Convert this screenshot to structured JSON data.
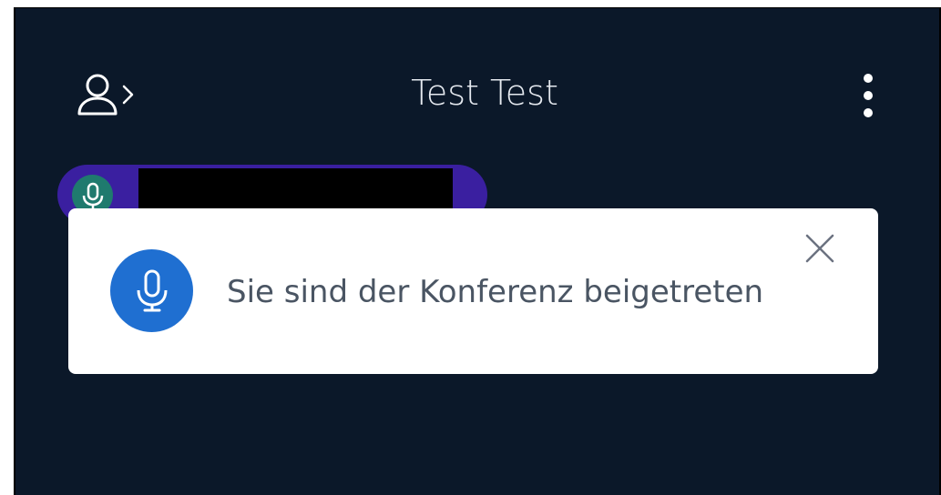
{
  "header": {
    "title": "Test Test",
    "participants_icon": "person-chevron-icon",
    "menu_icon": "more-vertical-icon"
  },
  "active_speaker": {
    "avatar_icon": "microphone-icon",
    "name": "",
    "chip_color": "#3a1fa0",
    "avatar_color": "#1f7a6e"
  },
  "notification": {
    "message": "Sie sind der Konferenz beigetreten",
    "icon": "microphone-icon",
    "icon_bg": "#1f6fd1",
    "close_icon": "close-icon"
  },
  "colors": {
    "background": "#0b1829",
    "toast_bg": "#ffffff"
  }
}
